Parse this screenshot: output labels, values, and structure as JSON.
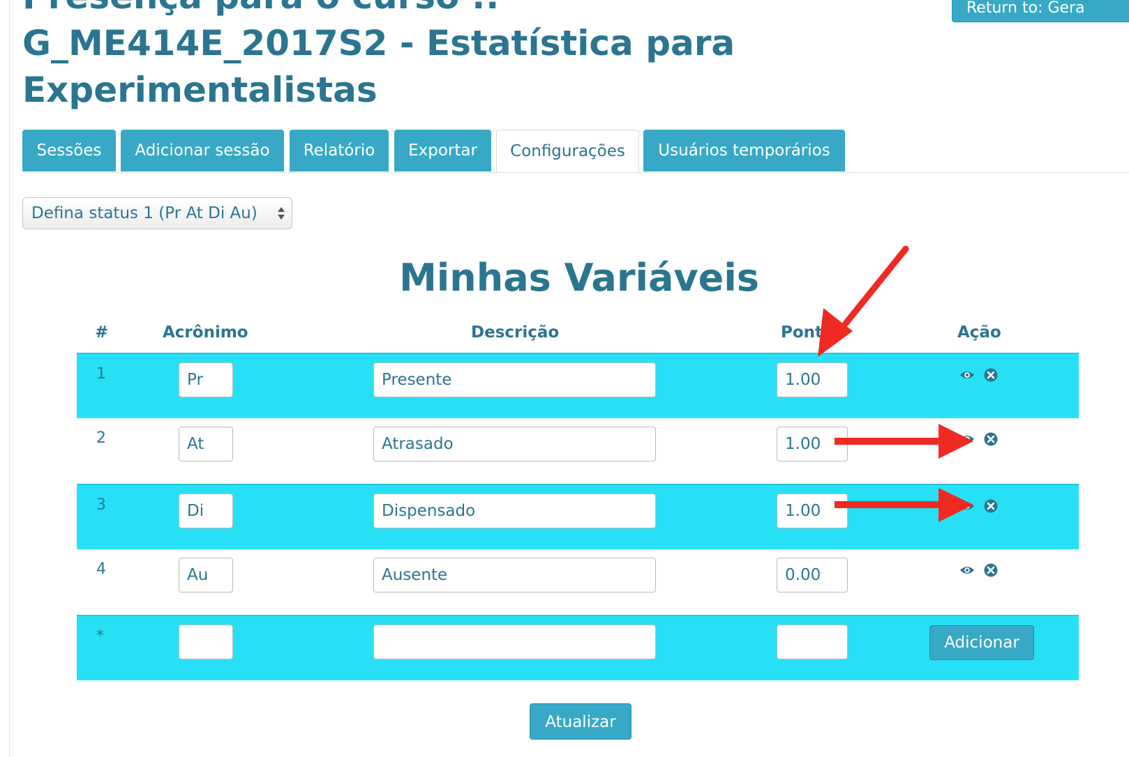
{
  "header": {
    "title_lines": [
      "Presença para o curso ::",
      "G_ME414E_2017S2 - Estatística para",
      "Experimentalistas"
    ],
    "return_label": "Return to: Gera"
  },
  "tabs": [
    {
      "label": "Sessões",
      "active": false
    },
    {
      "label": "Adicionar sessão",
      "active": false
    },
    {
      "label": "Relatório",
      "active": false
    },
    {
      "label": "Exportar",
      "active": false
    },
    {
      "label": "Configurações",
      "active": true
    },
    {
      "label": "Usuários temporários",
      "active": false
    }
  ],
  "status_select": {
    "value": "Defina status 1 (Pr At Di Au)"
  },
  "section": {
    "title": "Minhas Variáveis"
  },
  "table": {
    "headers": {
      "num": "#",
      "acronym": "Acrônimo",
      "description": "Descrição",
      "points": "Pont",
      "action": "Ação"
    },
    "rows": [
      {
        "num": "1",
        "acronym": "Pr",
        "description": "Presente",
        "points": "1.00"
      },
      {
        "num": "2",
        "acronym": "At",
        "description": "Atrasado",
        "points": "1.00"
      },
      {
        "num": "3",
        "acronym": "Di",
        "description": "Dispensado",
        "points": "1.00"
      },
      {
        "num": "4",
        "acronym": "Au",
        "description": "Ausente",
        "points": "0.00"
      }
    ],
    "new_row": {
      "num": "*",
      "acronym": "",
      "description": "",
      "points": ""
    },
    "add_label": "Adicionar"
  },
  "update_label": "Atualizar",
  "colors": {
    "accent": "#37a9c6",
    "row_highlight": "#28e0f6",
    "text": "#2b7590",
    "arrow": "#ee2a22"
  },
  "icons": {
    "visibility": "eye-icon",
    "delete": "close-circle-icon"
  }
}
